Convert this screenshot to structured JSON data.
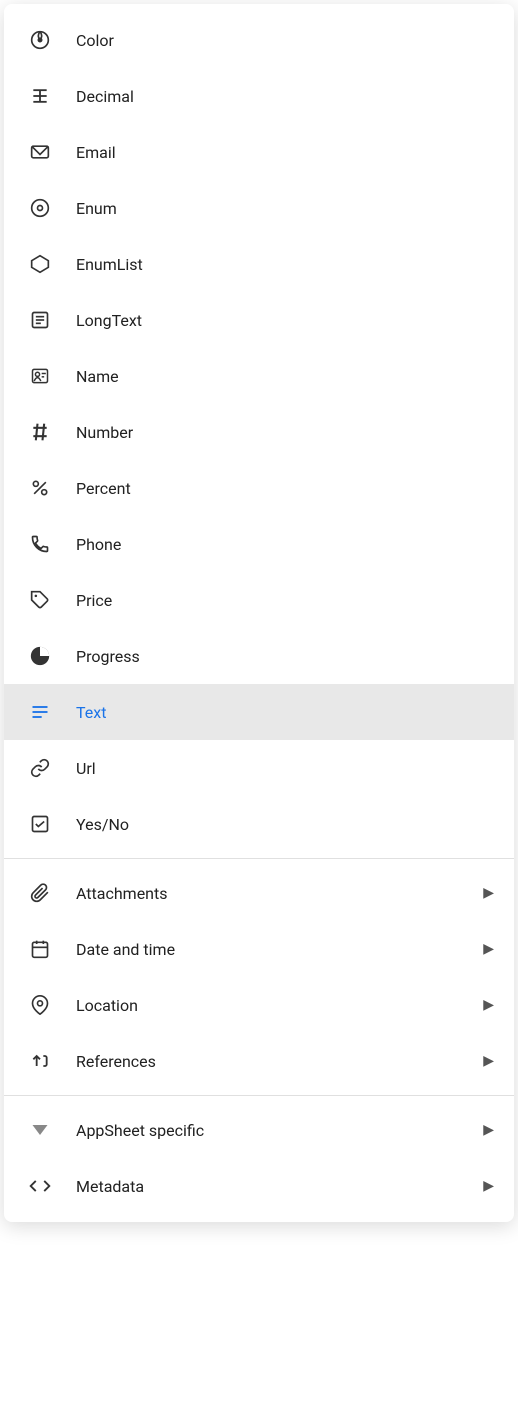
{
  "menu": {
    "items": [
      {
        "id": "color",
        "label": "Color",
        "icon": "color",
        "hasArrow": false,
        "selected": false
      },
      {
        "id": "decimal",
        "label": "Decimal",
        "icon": "decimal",
        "hasArrow": false,
        "selected": false
      },
      {
        "id": "email",
        "label": "Email",
        "icon": "email",
        "hasArrow": false,
        "selected": false
      },
      {
        "id": "enum",
        "label": "Enum",
        "icon": "enum",
        "hasArrow": false,
        "selected": false
      },
      {
        "id": "enumlist",
        "label": "EnumList",
        "icon": "enumlist",
        "hasArrow": false,
        "selected": false
      },
      {
        "id": "longtext",
        "label": "LongText",
        "icon": "longtext",
        "hasArrow": false,
        "selected": false
      },
      {
        "id": "name",
        "label": "Name",
        "icon": "name",
        "hasArrow": false,
        "selected": false
      },
      {
        "id": "number",
        "label": "Number",
        "icon": "number",
        "hasArrow": false,
        "selected": false
      },
      {
        "id": "percent",
        "label": "Percent",
        "icon": "percent",
        "hasArrow": false,
        "selected": false
      },
      {
        "id": "phone",
        "label": "Phone",
        "icon": "phone",
        "hasArrow": false,
        "selected": false
      },
      {
        "id": "price",
        "label": "Price",
        "icon": "price",
        "hasArrow": false,
        "selected": false
      },
      {
        "id": "progress",
        "label": "Progress",
        "icon": "progress",
        "hasArrow": false,
        "selected": false
      },
      {
        "id": "text",
        "label": "Text",
        "icon": "text",
        "hasArrow": false,
        "selected": true
      },
      {
        "id": "url",
        "label": "Url",
        "icon": "url",
        "hasArrow": false,
        "selected": false
      },
      {
        "id": "yesno",
        "label": "Yes/No",
        "icon": "yesno",
        "hasArrow": false,
        "selected": false
      }
    ],
    "group2": [
      {
        "id": "attachments",
        "label": "Attachments",
        "icon": "attachments",
        "hasArrow": true,
        "selected": false
      },
      {
        "id": "datetime",
        "label": "Date and time",
        "icon": "datetime",
        "hasArrow": true,
        "selected": false
      },
      {
        "id": "location",
        "label": "Location",
        "icon": "location",
        "hasArrow": true,
        "selected": false
      },
      {
        "id": "references",
        "label": "References",
        "icon": "references",
        "hasArrow": true,
        "selected": false
      }
    ],
    "group3": [
      {
        "id": "appsheet",
        "label": "AppSheet specific",
        "icon": "appsheet",
        "hasArrow": true,
        "selected": false
      },
      {
        "id": "metadata",
        "label": "Metadata",
        "icon": "metadata",
        "hasArrow": true,
        "selected": false
      }
    ],
    "chevron": "▶"
  }
}
